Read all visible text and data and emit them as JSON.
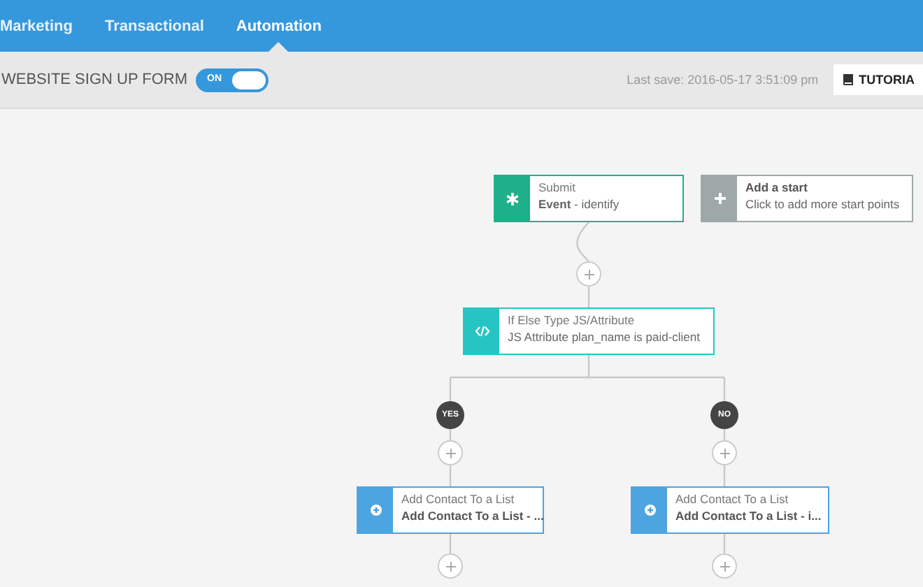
{
  "tabs": [
    {
      "label": "Marketing",
      "selected": false
    },
    {
      "label": "Transactional",
      "selected": false
    },
    {
      "label": "Automation",
      "selected": true
    }
  ],
  "header": {
    "title": "WEBSITE SIGN UP FORM",
    "toggle": {
      "label": "ON",
      "on": true
    },
    "last_save": "Last save: 2016-05-17 3:51:09 pm",
    "tutorial_button": "TUTORIA"
  },
  "nodes": [
    {
      "kind": "event",
      "title": "Submit",
      "subtitle": "**Event** - identify"
    },
    {
      "kind": "start",
      "title": "Add a start",
      "subtitle": "Click to add more start points"
    },
    {
      "kind": "condition",
      "title": "If Else Type JS/Attribute",
      "subtitle": "JS Attribute plan_name is paid-client"
    },
    {
      "kind": "action",
      "title": "Add Contact To a List",
      "subtitle": "Add Contact To a List - ..."
    },
    {
      "kind": "action",
      "title": "Add Contact To a List",
      "subtitle": "Add Contact To a List - i..."
    }
  ],
  "branches": [
    "YES",
    "NO"
  ]
}
